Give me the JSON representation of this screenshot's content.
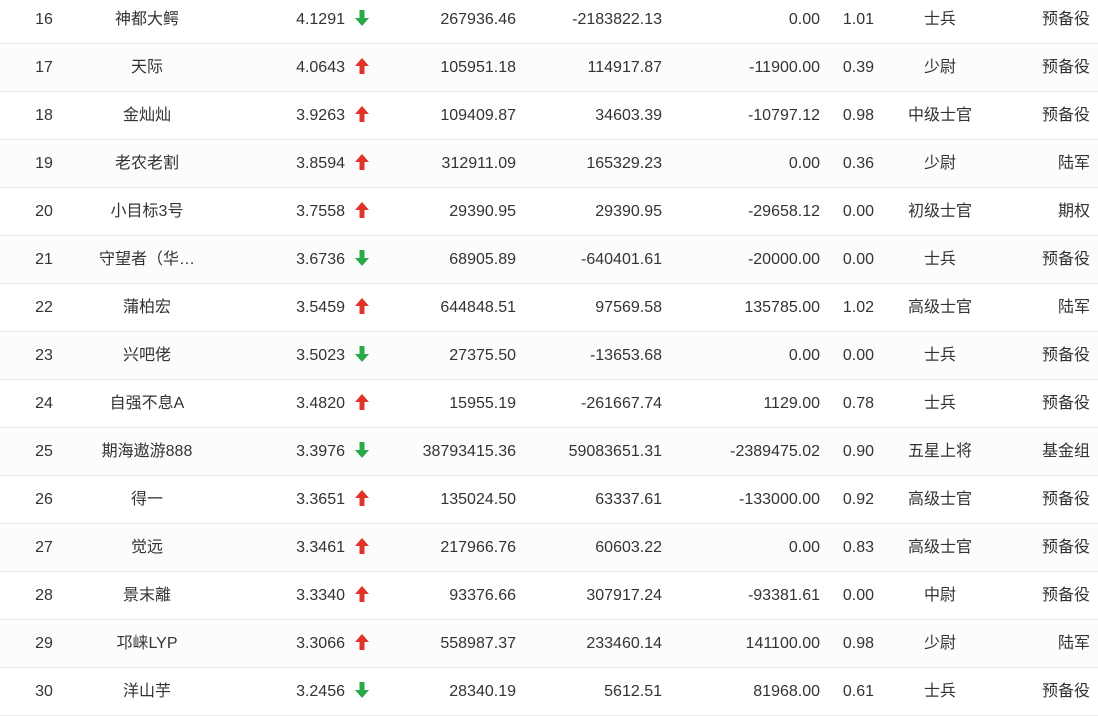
{
  "colors": {
    "up": "#e0342b",
    "down": "#2aa84a",
    "text": "#333333"
  },
  "rows": [
    {
      "rank": "16",
      "name": "神都大鳄",
      "score": "4.1291",
      "trend": "down",
      "v1": "267936.46",
      "v2": "-2183822.13",
      "v3": "0.00",
      "v4": "1.01",
      "rank_title": "士兵",
      "group": "预备役"
    },
    {
      "rank": "17",
      "name": "天际",
      "score": "4.0643",
      "trend": "up",
      "v1": "105951.18",
      "v2": "114917.87",
      "v3": "-11900.00",
      "v4": "0.39",
      "rank_title": "少尉",
      "group": "预备役"
    },
    {
      "rank": "18",
      "name": "金灿灿",
      "score": "3.9263",
      "trend": "up",
      "v1": "109409.87",
      "v2": "34603.39",
      "v3": "-10797.12",
      "v4": "0.98",
      "rank_title": "中级士官",
      "group": "预备役"
    },
    {
      "rank": "19",
      "name": "老农老割",
      "score": "3.8594",
      "trend": "up",
      "v1": "312911.09",
      "v2": "165329.23",
      "v3": "0.00",
      "v4": "0.36",
      "rank_title": "少尉",
      "group": "陆军"
    },
    {
      "rank": "20",
      "name": "小目标3号",
      "score": "3.7558",
      "trend": "up",
      "v1": "29390.95",
      "v2": "29390.95",
      "v3": "-29658.12",
      "v4": "0.00",
      "rank_title": "初级士官",
      "group": "期权"
    },
    {
      "rank": "21",
      "name": "守望者（华…",
      "score": "3.6736",
      "trend": "down",
      "v1": "68905.89",
      "v2": "-640401.61",
      "v3": "-20000.00",
      "v4": "0.00",
      "rank_title": "士兵",
      "group": "预备役"
    },
    {
      "rank": "22",
      "name": "蒲柏宏",
      "score": "3.5459",
      "trend": "up",
      "v1": "644848.51",
      "v2": "97569.58",
      "v3": "135785.00",
      "v4": "1.02",
      "rank_title": "高级士官",
      "group": "陆军"
    },
    {
      "rank": "23",
      "name": "兴吧佬",
      "score": "3.5023",
      "trend": "down",
      "v1": "27375.50",
      "v2": "-13653.68",
      "v3": "0.00",
      "v4": "0.00",
      "rank_title": "士兵",
      "group": "预备役"
    },
    {
      "rank": "24",
      "name": "自强不息A",
      "score": "3.4820",
      "trend": "up",
      "v1": "15955.19",
      "v2": "-261667.74",
      "v3": "1129.00",
      "v4": "0.78",
      "rank_title": "士兵",
      "group": "预备役"
    },
    {
      "rank": "25",
      "name": "期海遨游888",
      "score": "3.3976",
      "trend": "down",
      "v1": "38793415.36",
      "v2": "59083651.31",
      "v3": "-2389475.02",
      "v4": "0.90",
      "rank_title": "五星上将",
      "group": "基金组"
    },
    {
      "rank": "26",
      "name": "得一",
      "score": "3.3651",
      "trend": "up",
      "v1": "135024.50",
      "v2": "63337.61",
      "v3": "-133000.00",
      "v4": "0.92",
      "rank_title": "高级士官",
      "group": "预备役"
    },
    {
      "rank": "27",
      "name": "觉远",
      "score": "3.3461",
      "trend": "up",
      "v1": "217966.76",
      "v2": "60603.22",
      "v3": "0.00",
      "v4": "0.83",
      "rank_title": "高级士官",
      "group": "预备役"
    },
    {
      "rank": "28",
      "name": "景末離",
      "score": "3.3340",
      "trend": "up",
      "v1": "93376.66",
      "v2": "307917.24",
      "v3": "-93381.61",
      "v4": "0.00",
      "rank_title": "中尉",
      "group": "预备役"
    },
    {
      "rank": "29",
      "name": "邛崃LYP",
      "score": "3.3066",
      "trend": "up",
      "v1": "558987.37",
      "v2": "233460.14",
      "v3": "141100.00",
      "v4": "0.98",
      "rank_title": "少尉",
      "group": "陆军"
    },
    {
      "rank": "30",
      "name": "洋山芋",
      "score": "3.2456",
      "trend": "down",
      "v1": "28340.19",
      "v2": "5612.51",
      "v3": "81968.00",
      "v4": "0.61",
      "rank_title": "士兵",
      "group": "预备役"
    }
  ]
}
